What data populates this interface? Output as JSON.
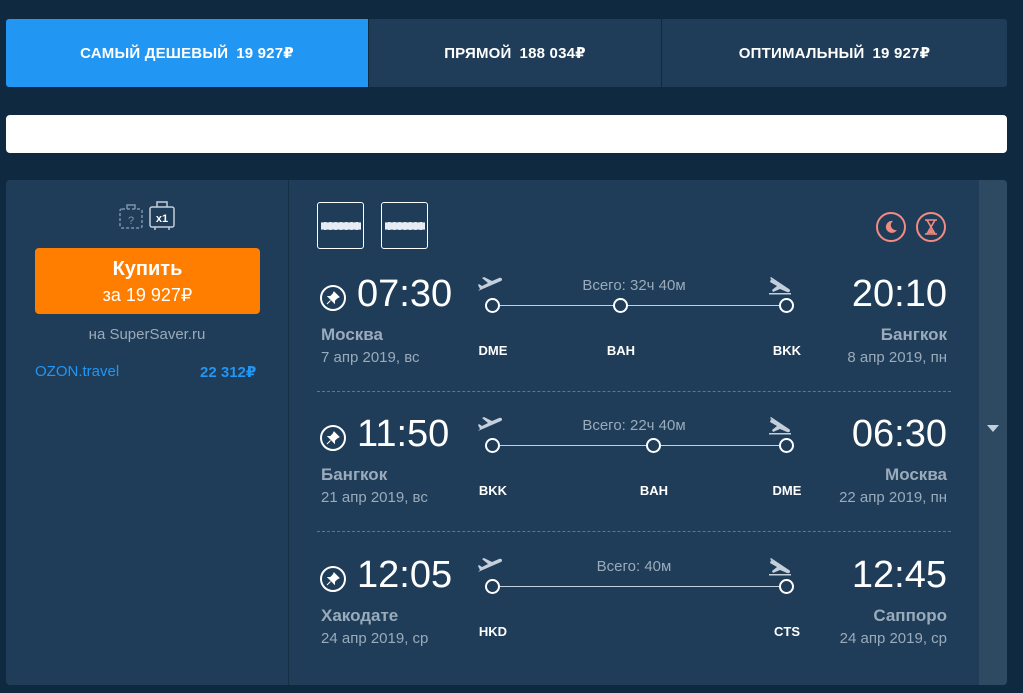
{
  "tabs": [
    {
      "label": "САМЫЙ ДЕШЕВЫЙ",
      "price": "19 927₽"
    },
    {
      "label": "ПРЯМОЙ",
      "price": "188 034₽"
    },
    {
      "label": "ОПТИМАЛЬНЫЙ",
      "price": "19 927₽"
    }
  ],
  "offer": {
    "baggage_count": "x1",
    "baggage_unknown": "?",
    "buy_label": "Купить",
    "buy_price": "за 19 927₽",
    "seller": "на SuperSaver.ru",
    "alt_agency": "OZON.travel",
    "alt_price": "22 312₽"
  },
  "colors": {
    "accent": "#2196f3",
    "buy": "#ff7e00",
    "card": "#1f3d58",
    "badge": "#f28b82"
  },
  "segments": [
    {
      "dep_time": "07:30",
      "arr_time": "20:10",
      "dep_city": "Москва",
      "arr_city": "Бангкок",
      "dep_date": "7 апр 2019, вс",
      "arr_date": "8 апр 2019, пн",
      "total": "Всего: 32ч 40м",
      "stops": [
        "DME",
        "BAH",
        "BKK"
      ]
    },
    {
      "dep_time": "11:50",
      "arr_time": "06:30",
      "dep_city": "Бангкок",
      "arr_city": "Москва",
      "dep_date": "21 апр 2019, вс",
      "arr_date": "22 апр 2019, пн",
      "total": "Всего: 22ч 40м",
      "stops": [
        "BKK",
        "BAH",
        "DME"
      ]
    },
    {
      "dep_time": "12:05",
      "arr_time": "12:45",
      "dep_city": "Хакодате",
      "arr_city": "Саппоро",
      "dep_date": "24 апр 2019, ср",
      "arr_date": "24 апр 2019, ср",
      "total": "Всего: 40м",
      "stops": [
        "HKD",
        "CTS"
      ]
    }
  ]
}
